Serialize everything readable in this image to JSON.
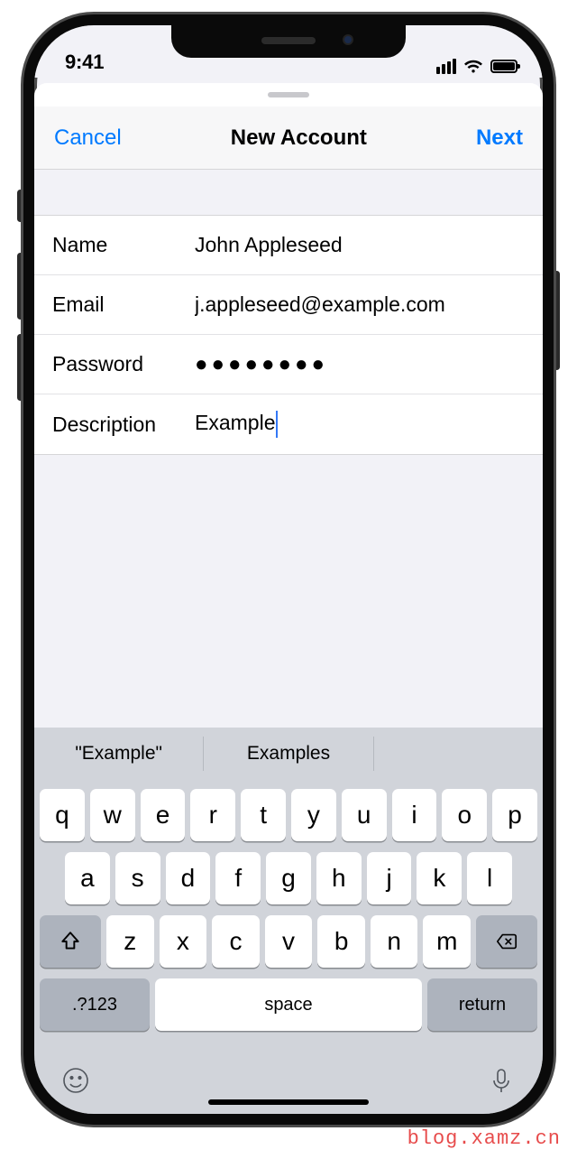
{
  "status": {
    "time": "9:41"
  },
  "nav": {
    "cancel": "Cancel",
    "title": "New Account",
    "next": "Next"
  },
  "form": {
    "name_label": "Name",
    "name_value": "John Appleseed",
    "email_label": "Email",
    "email_value": "j.appleseed@example.com",
    "password_label": "Password",
    "password_mask": "●●●●●●●●",
    "description_label": "Description",
    "description_value": "Example"
  },
  "keyboard": {
    "predictions": [
      "\"Example\"",
      "Examples"
    ],
    "row1": [
      "q",
      "w",
      "e",
      "r",
      "t",
      "y",
      "u",
      "i",
      "o",
      "p"
    ],
    "row2": [
      "a",
      "s",
      "d",
      "f",
      "g",
      "h",
      "j",
      "k",
      "l"
    ],
    "row3": [
      "z",
      "x",
      "c",
      "v",
      "b",
      "n",
      "m"
    ],
    "num_key": ".?123",
    "space_key": "space",
    "return_key": "return"
  },
  "watermark": "blog.xamz.cn"
}
